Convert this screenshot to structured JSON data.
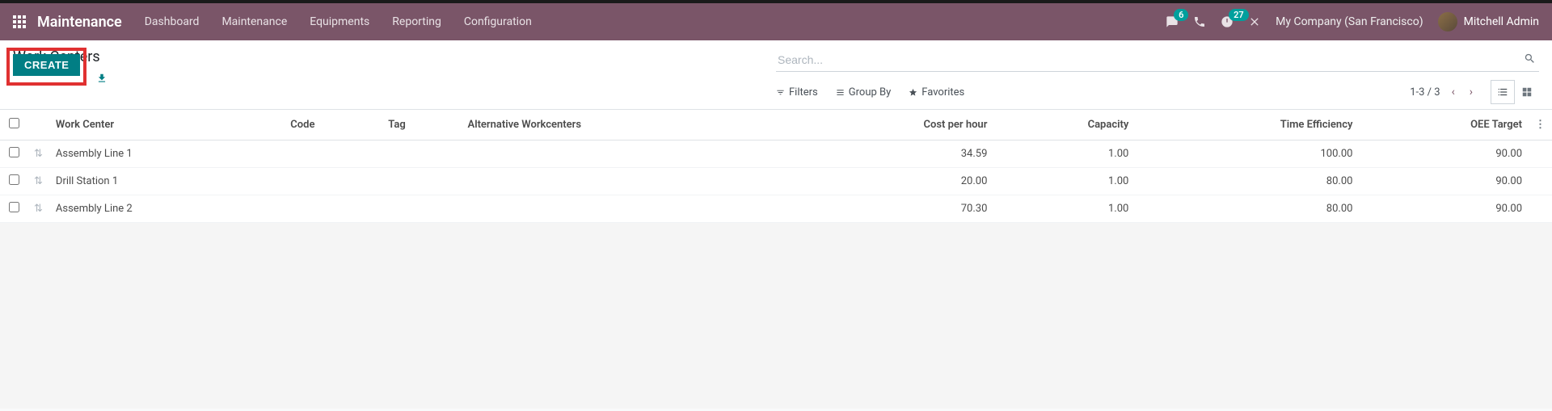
{
  "nav": {
    "brand": "Maintenance",
    "items": [
      "Dashboard",
      "Maintenance",
      "Equipments",
      "Reporting",
      "Configuration"
    ],
    "chat_badge": "6",
    "activity_badge": "27",
    "company": "My Company (San Francisco)",
    "user": "Mitchell Admin"
  },
  "cp": {
    "title": "Work Centers",
    "create": "CREATE",
    "search_placeholder": "Search...",
    "filters": "Filters",
    "groupby": "Group By",
    "favorites": "Favorites",
    "pager": "1-3 / 3"
  },
  "table": {
    "headers": {
      "work_center": "Work Center",
      "code": "Code",
      "tag": "Tag",
      "alt": "Alternative Workcenters",
      "cost": "Cost per hour",
      "capacity": "Capacity",
      "eff": "Time Efficiency",
      "oee": "OEE Target"
    },
    "rows": [
      {
        "name": "Assembly Line 1",
        "code": "",
        "tag": "",
        "alt": "",
        "cost": "34.59",
        "capacity": "1.00",
        "eff": "100.00",
        "oee": "90.00"
      },
      {
        "name": "Drill Station 1",
        "code": "",
        "tag": "",
        "alt": "",
        "cost": "20.00",
        "capacity": "1.00",
        "eff": "80.00",
        "oee": "90.00"
      },
      {
        "name": "Assembly Line 2",
        "code": "",
        "tag": "",
        "alt": "",
        "cost": "70.30",
        "capacity": "1.00",
        "eff": "80.00",
        "oee": "90.00"
      }
    ]
  }
}
